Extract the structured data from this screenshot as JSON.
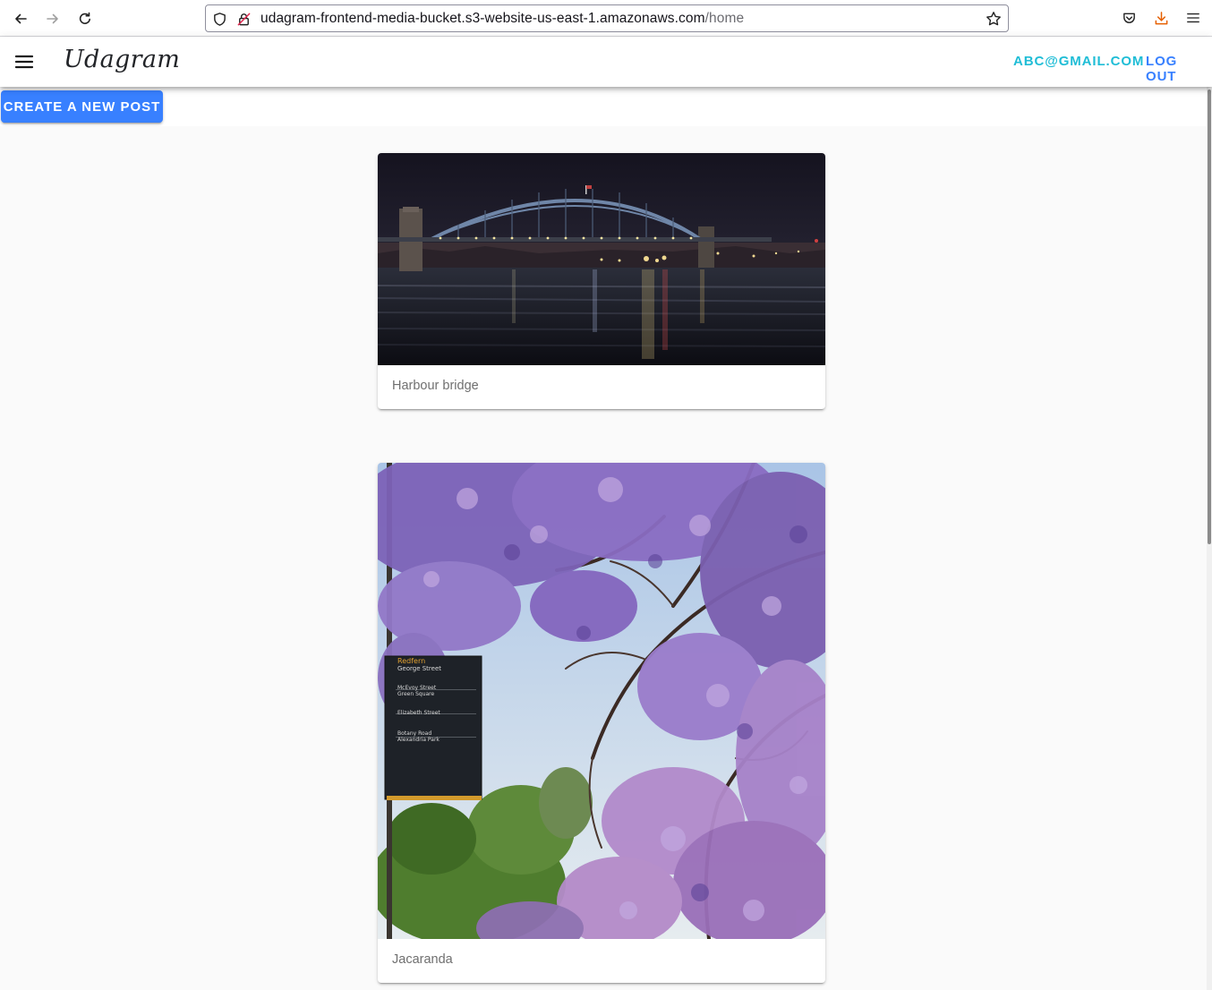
{
  "browser": {
    "url_host": "udagram-frontend-media-bucket.s3-website-us-east-1.amazonaws.com",
    "url_path": "/home",
    "icons": [
      "back-arrow-icon",
      "forward-arrow-icon",
      "reload-icon",
      "shield-icon",
      "lock-insecure-icon",
      "bookmark-star-icon",
      "pocket-icon",
      "download-icon",
      "hamburger-menu-icon"
    ]
  },
  "app": {
    "brand": "Udagram",
    "user_email": "ABC@GMAIL.COM",
    "logout_label": "LOG OUT",
    "create_post_label": "CREATE A NEW POST",
    "colors": {
      "primary": "#3880ff",
      "secondary": "#1fbdd6",
      "brand_text": "#222428"
    }
  },
  "feed": {
    "posts": [
      {
        "caption": "Harbour bridge",
        "image": "night-harbour-bridge-photo"
      },
      {
        "caption": "Jacaranda",
        "image": "jacaranda-tree-photo"
      }
    ],
    "sign": {
      "title": "Redfern",
      "subtitle": "George Street",
      "lines": [
        "McEvoy Street",
        "Green Square",
        "Elizabeth Street",
        "Botany Road",
        "Alexandria Park"
      ]
    }
  }
}
